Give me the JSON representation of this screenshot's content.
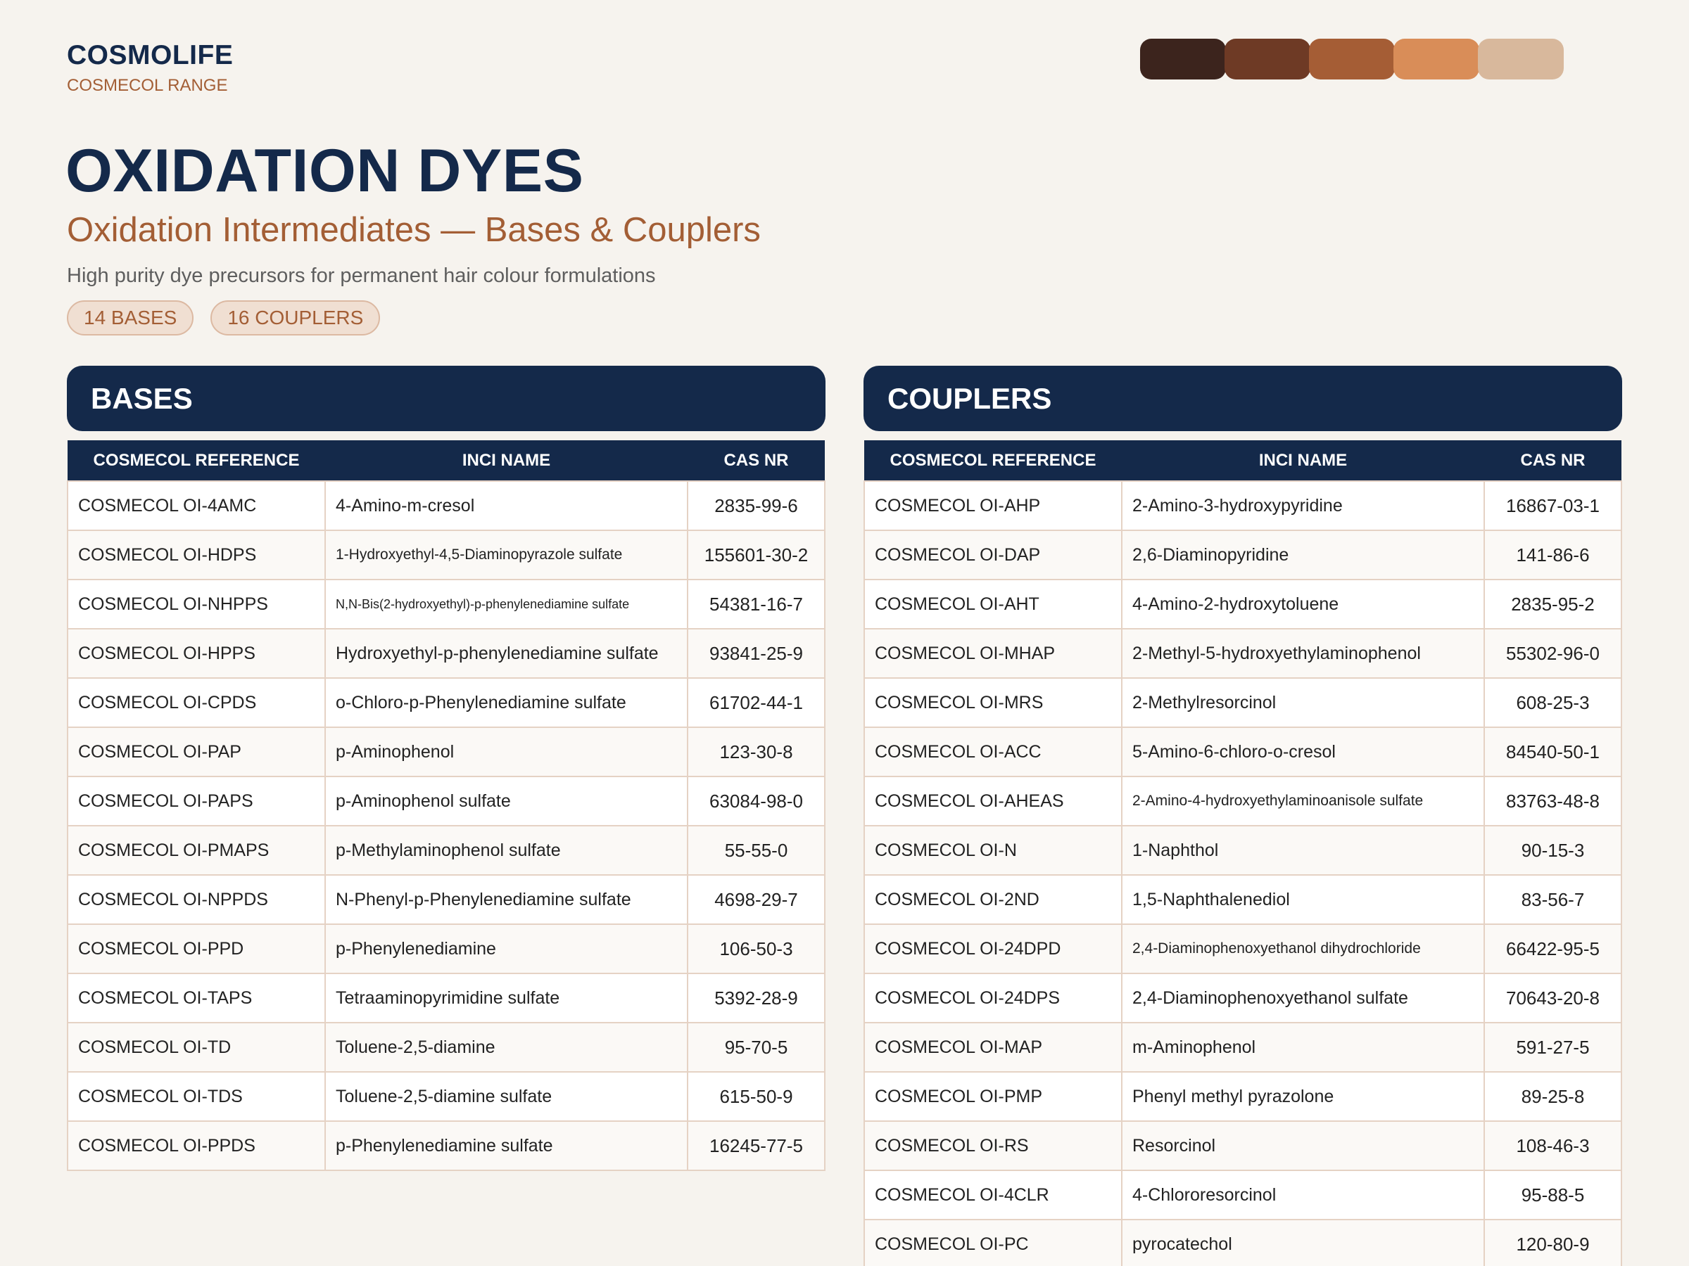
{
  "brand": {
    "name": "COSMOLIFE",
    "range": "COSMECOL RANGE"
  },
  "swatches": [
    "#3c241d",
    "#6e3a25",
    "#a55d35",
    "#d98d58",
    "#d8b89c"
  ],
  "title": "OXIDATION DYES",
  "subtitle": "Oxidation Intermediates — Bases & Couplers",
  "tagline": "High purity dye precursors for permanent hair colour formulations",
  "badges": [
    "14 BASES",
    "16 COUPLERS"
  ],
  "columns": [
    "COSMECOL REFERENCE",
    "INCI NAME",
    "CAS NR"
  ],
  "bases": {
    "title": "BASES",
    "rows": [
      [
        "COSMECOL OI-4AMC",
        "4-Amino-m-cresol",
        "2835-99-6"
      ],
      [
        "COSMECOL OI-HDPS",
        "1-Hydroxyethyl-4,5-Diaminopyrazole sulfate",
        "155601-30-2"
      ],
      [
        "COSMECOL OI-NHPPS",
        "N,N-Bis(2-hydroxyethyl)-p-phenylenediamine sulfate",
        "54381-16-7"
      ],
      [
        "COSMECOL OI-HPPS",
        "Hydroxyethyl-p-phenylenediamine sulfate",
        "93841-25-9"
      ],
      [
        "COSMECOL OI-CPDS",
        "o-Chloro-p-Phenylenediamine sulfate",
        "61702-44-1"
      ],
      [
        "COSMECOL OI-PAP",
        "p-Aminophenol",
        "123-30-8"
      ],
      [
        "COSMECOL OI-PAPS",
        "p-Aminophenol sulfate",
        "63084-98-0"
      ],
      [
        "COSMECOL OI-PMAPS",
        "p-Methylaminophenol sulfate",
        "55-55-0"
      ],
      [
        "COSMECOL OI-NPPDS",
        "N-Phenyl-p-Phenylenediamine sulfate",
        "4698-29-7"
      ],
      [
        "COSMECOL OI-PPD",
        "p-Phenylenediamine",
        "106-50-3"
      ],
      [
        "COSMECOL OI-TAPS",
        "Tetraaminopyrimidine sulfate",
        "5392-28-9"
      ],
      [
        "COSMECOL OI-TD",
        "Toluene-2,5-diamine",
        "95-70-5"
      ],
      [
        "COSMECOL OI-TDS",
        "Toluene-2,5-diamine sulfate",
        "615-50-9"
      ],
      [
        "COSMECOL OI-PPDS",
        "p-Phenylenediamine sulfate",
        "16245-77-5"
      ]
    ]
  },
  "couplers": {
    "title": "COUPLERS",
    "rows": [
      [
        "COSMECOL OI-AHP",
        "2-Amino-3-hydroxypyridine",
        "16867-03-1"
      ],
      [
        "COSMECOL OI-DAP",
        "2,6-Diaminopyridine",
        "141-86-6"
      ],
      [
        "COSMECOL OI-AHT",
        "4-Amino-2-hydroxytoluene",
        "2835-95-2"
      ],
      [
        "COSMECOL OI-MHAP",
        "2-Methyl-5-hydroxyethylaminophenol",
        "55302-96-0"
      ],
      [
        "COSMECOL OI-MRS",
        "2-Methylresorcinol",
        "608-25-3"
      ],
      [
        "COSMECOL OI-ACC",
        "5-Amino-6-chloro-o-cresol",
        "84540-50-1"
      ],
      [
        "COSMECOL OI-AHEAS",
        "2-Amino-4-hydroxyethylaminoanisole sulfate",
        "83763-48-8"
      ],
      [
        "COSMECOL OI-N",
        "1-Naphthol",
        "90-15-3"
      ],
      [
        "COSMECOL OI-2ND",
        "1,5-Naphthalenediol",
        "83-56-7"
      ],
      [
        "COSMECOL OI-24DPD",
        "2,4-Diaminophenoxyethanol dihydrochloride",
        "66422-95-5"
      ],
      [
        "COSMECOL OI-24DPS",
        "2,4-Diaminophenoxyethanol sulfate",
        "70643-20-8"
      ],
      [
        "COSMECOL OI-MAP",
        "m-Aminophenol",
        "591-27-5"
      ],
      [
        "COSMECOL OI-PMP",
        "Phenyl methyl pyrazolone",
        "89-25-8"
      ],
      [
        "COSMECOL OI-RS",
        "Resorcinol",
        "108-46-3"
      ],
      [
        "COSMECOL OI-4CLR",
        "4-Chlororesorcinol",
        "95-88-5"
      ],
      [
        "COSMECOL OI-PC",
        "pyrocatechol",
        "120-80-9"
      ]
    ]
  }
}
